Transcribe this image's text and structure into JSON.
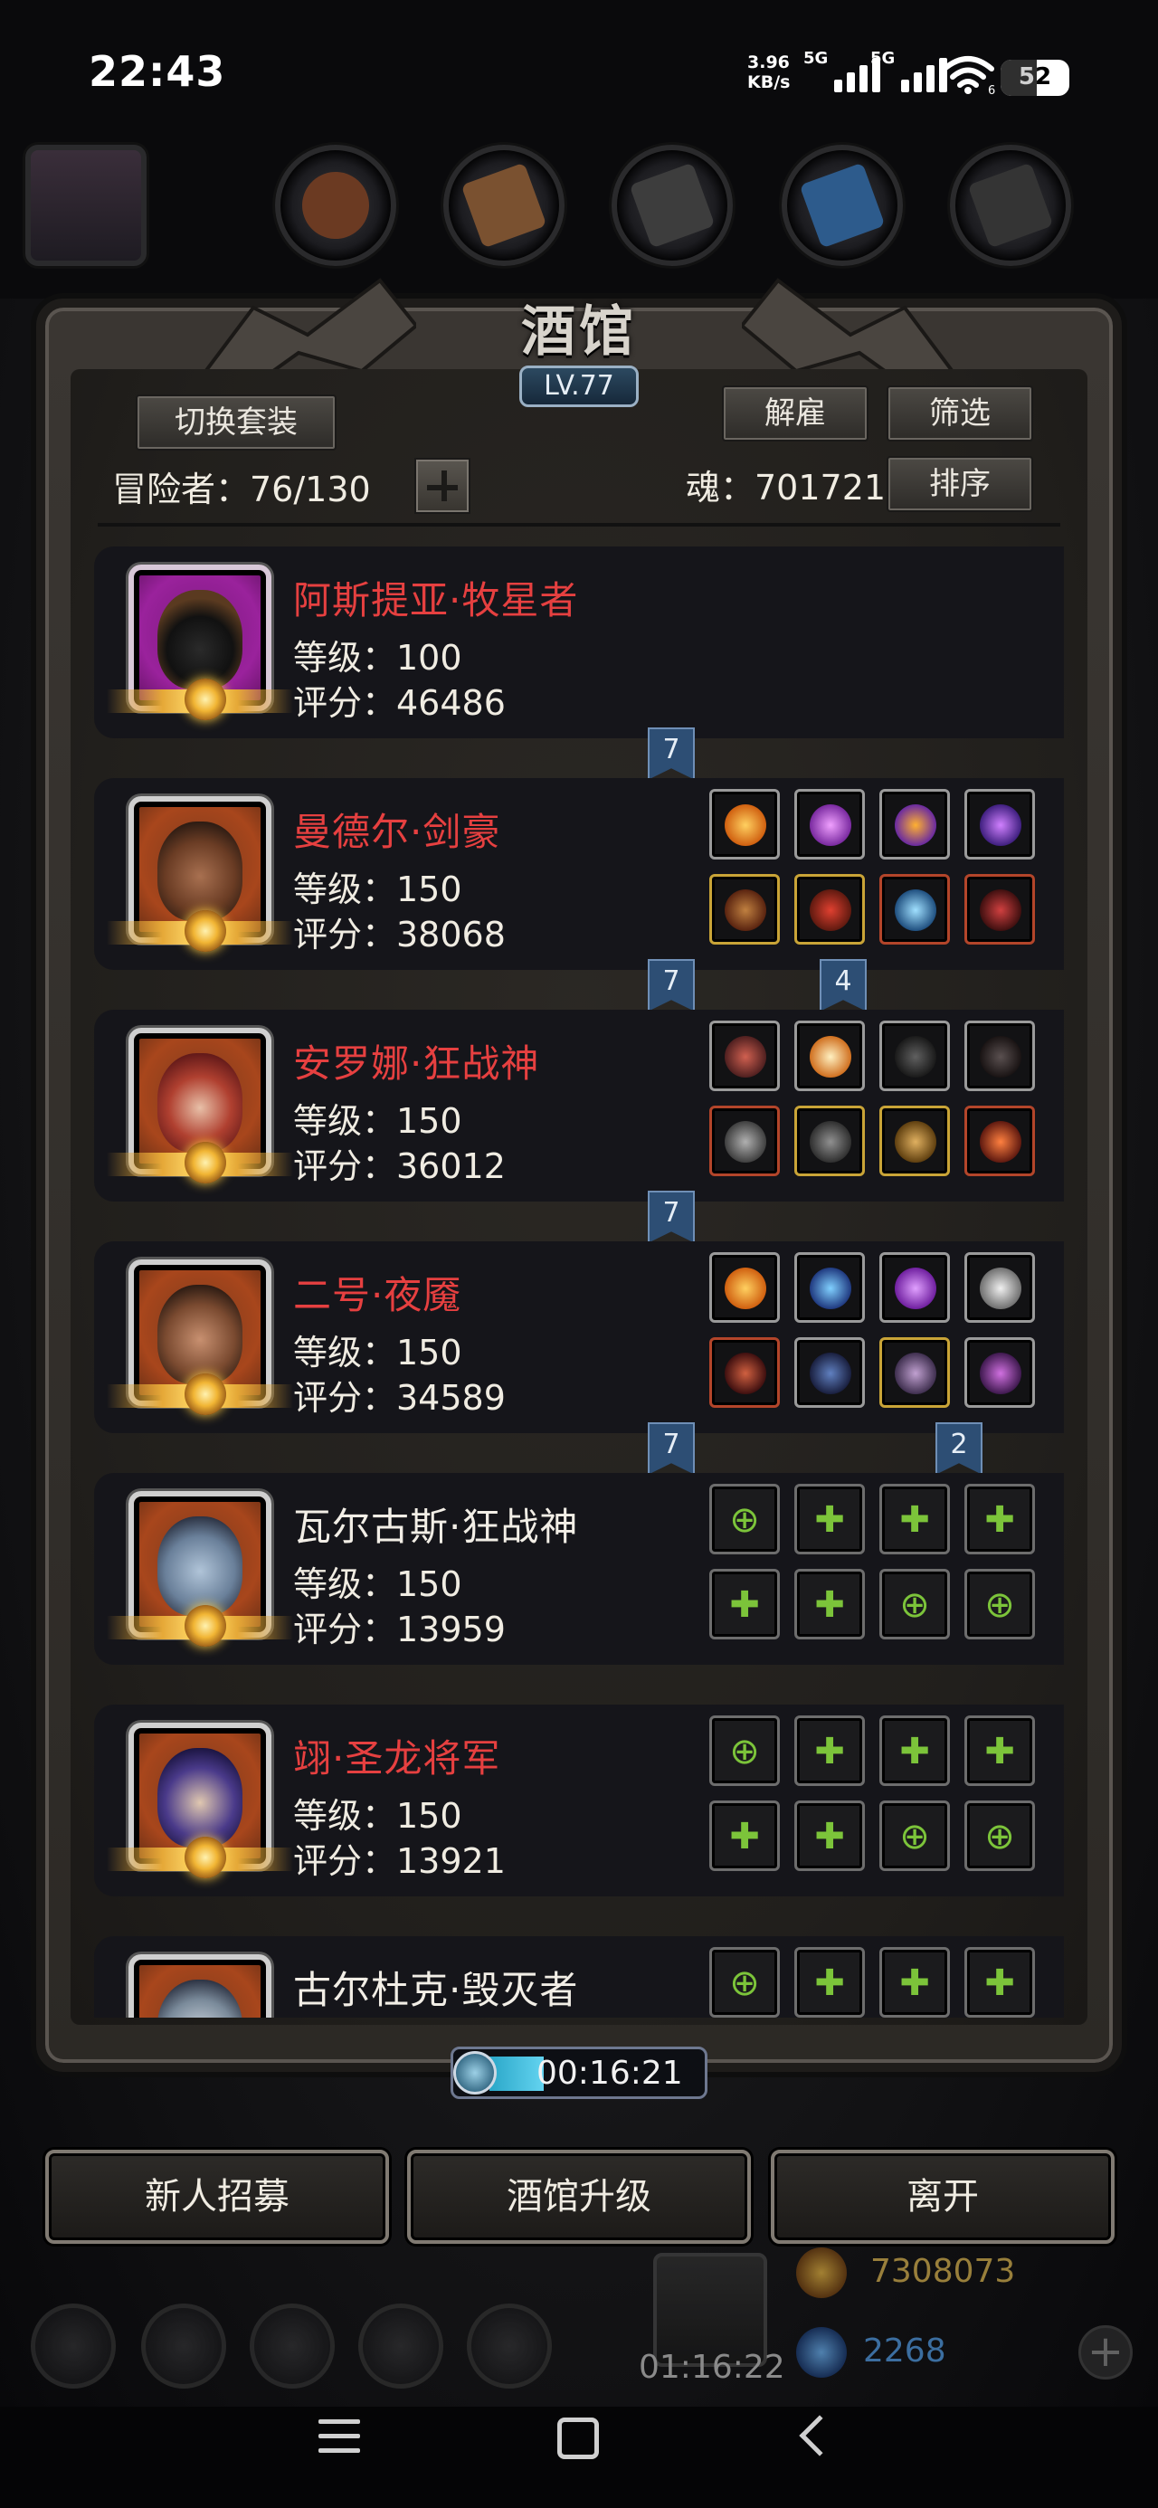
{
  "status_bar": {
    "time": "22:43",
    "net_speed_value": "3.96",
    "net_speed_unit": "KB/s",
    "sim1_tag": "5G",
    "sim2_tag": "5G",
    "wifi_tag": "6",
    "battery": "52"
  },
  "tavern": {
    "title": "酒馆",
    "level": "LV.77",
    "switch_outfit_label": "切换套装",
    "dismiss_label": "解雇",
    "filter_label": "筛选",
    "sort_label": "排序",
    "adventurers_text": "冒险者：76/130",
    "soul_text": "魂：701721"
  },
  "heroes": [
    {
      "name": "阿斯提亚·牧星者",
      "level": "等级：100",
      "score": "评分：46486",
      "name_color": "#e64040"
    },
    {
      "name": "曼德尔·剑豪",
      "level": "等级：150",
      "score": "评分：38068",
      "name_color": "#e64040"
    },
    {
      "name": "安罗娜·狂战神",
      "level": "等级：150",
      "score": "评分：36012",
      "name_color": "#e64040"
    },
    {
      "name": "二号·夜魇",
      "level": "等级：150",
      "score": "评分：34589",
      "name_color": "#e64040"
    },
    {
      "name": "瓦尔古斯·狂战神",
      "level": "等级：150",
      "score": "评分：13959",
      "name_color": "#f2eee6"
    },
    {
      "name": "翊·圣龙将军",
      "level": "等级：150",
      "score": "评分：13921",
      "name_color": "#e64040"
    },
    {
      "name": "古尔杜克·毁灭者",
      "name_color": "#f2eee6"
    }
  ],
  "ribbons": {
    "r1": "7",
    "r2": "7",
    "r2b": "4",
    "r3": "7",
    "r4": "7",
    "r4b": "2"
  },
  "timer": "00:16:21",
  "bottom_buttons": {
    "recruit": "新人招募",
    "upgrade": "酒馆升级",
    "leave": "离开"
  },
  "hud": {
    "gold": "7308073",
    "gems": "2268",
    "gift_timer": "01:16:22"
  }
}
